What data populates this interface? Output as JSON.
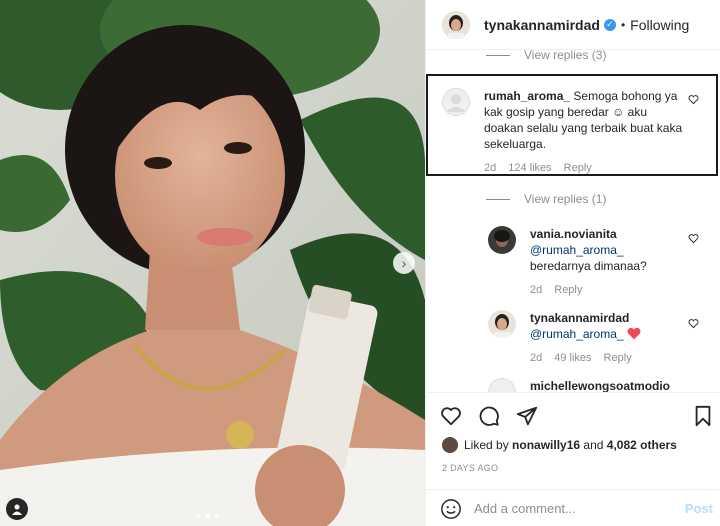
{
  "header": {
    "username": "tynakannamirdad",
    "verified_icon": "verified-badge-icon",
    "separator": "•",
    "follow_label": "Following"
  },
  "comments": {
    "view_replies_top": "View replies (3)",
    "highlighted": {
      "username": "rumah_aroma_",
      "text": "Semoga bohong ya kak gosip yang beredar ☺ aku doakan selalu yang terbaik buat kaka sekeluarga.",
      "time": "2d",
      "likes": "124 likes",
      "reply": "Reply"
    },
    "view_replies_mid": "View replies (1)",
    "replies": [
      {
        "username": "vania.novianita",
        "mention": "@rumah_aroma_",
        "text": "beredarnya dimanaa?",
        "time": "2d",
        "reply": "Reply"
      },
      {
        "username": "tynakannamirdad",
        "mention": "@rumah_aroma_",
        "text": "",
        "time": "2d",
        "likes": "49 likes",
        "reply": "Reply"
      },
      {
        "username": "michellewongsoatmodio"
      }
    ]
  },
  "actions": {
    "liked_by_prefix": "Liked by",
    "liked_by_user": "nonawilly16",
    "liked_by_and": "and",
    "liked_by_others": "4,082 others",
    "date": "2 DAYS AGO"
  },
  "add_comment": {
    "placeholder": "Add a comment...",
    "post_label": "Post"
  },
  "colors": {
    "verified": "#3897f0",
    "mention": "#00376b",
    "post_disabled": "#b2dffc",
    "heart_red": "#ed4956",
    "muted": "#8e8e8e"
  },
  "photo": {
    "carousel_total": 3,
    "carousel_active": 2,
    "icons": [
      "chevron-right-icon",
      "tag-person-icon"
    ]
  }
}
